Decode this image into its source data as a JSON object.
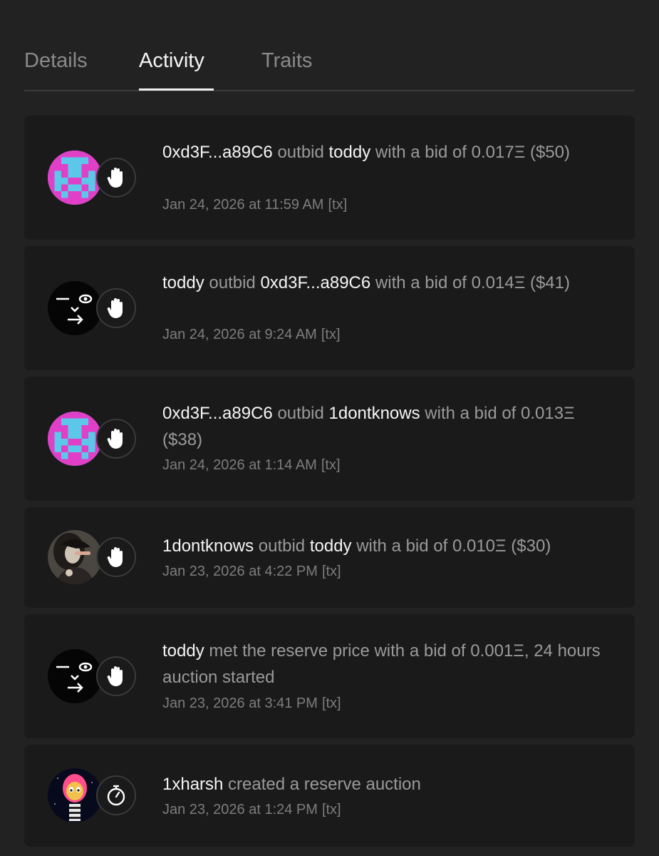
{
  "tabs": [
    {
      "label": "Details",
      "active": false
    },
    {
      "label": "Activity",
      "active": true
    },
    {
      "label": "Traits",
      "active": false
    }
  ],
  "activity": [
    {
      "avatar": "pixel-avatar",
      "badge": "hand-icon",
      "p1": "0xd3F...a89C6",
      "verb": " outbid ",
      "p2": "toddy",
      "rest": " with a bid of 0.017Ξ ($50)",
      "date": "Jan 24, 2026 at 11:59 AM",
      "tx": "[tx]"
    },
    {
      "avatar": "face-avatar",
      "badge": "hand-icon",
      "p1": "toddy",
      "verb": " outbid ",
      "p2": "0xd3F...a89C6",
      "rest": " with a bid of 0.014Ξ ($41)",
      "date": "Jan 24, 2026 at 9:24 AM",
      "tx": "[tx]"
    },
    {
      "avatar": "pixel-avatar",
      "badge": "hand-icon",
      "p1": "0xd3F...a89C6",
      "verb": " outbid ",
      "p2": "1dontknows",
      "rest": " with a bid of 0.013Ξ ($38)",
      "date": "Jan 24, 2026 at 1:14 AM",
      "tx": "[tx]"
    },
    {
      "avatar": "photo-avatar",
      "badge": "hand-icon",
      "p1": "1dontknows",
      "verb": " outbid ",
      "p2": "toddy",
      "rest": " with a bid of 0.010Ξ ($30)",
      "date": "Jan 23, 2026 at 4:22 PM",
      "tx": "[tx]"
    },
    {
      "avatar": "face-avatar",
      "badge": "hand-icon",
      "p1": "toddy",
      "verb": "",
      "p2": "",
      "rest": " met the reserve price with a bid of 0.001Ξ, 24 hours auction started",
      "date": "Jan 23, 2026 at 3:41 PM",
      "tx": "[tx]"
    },
    {
      "avatar": "character-avatar",
      "badge": "stopwatch-icon",
      "p1": "1xharsh",
      "verb": "",
      "p2": "",
      "rest": " created a reserve auction",
      "date": "Jan 23, 2026 at 1:24 PM",
      "tx": "[tx]"
    }
  ],
  "colors": {
    "background": "#222222",
    "card": "#1a1a1a",
    "text_primary": "#f5f5f5",
    "text_secondary": "#9a9a9a",
    "pixel_pink": "#e040c8",
    "pixel_cyan": "#5cc7e8"
  }
}
